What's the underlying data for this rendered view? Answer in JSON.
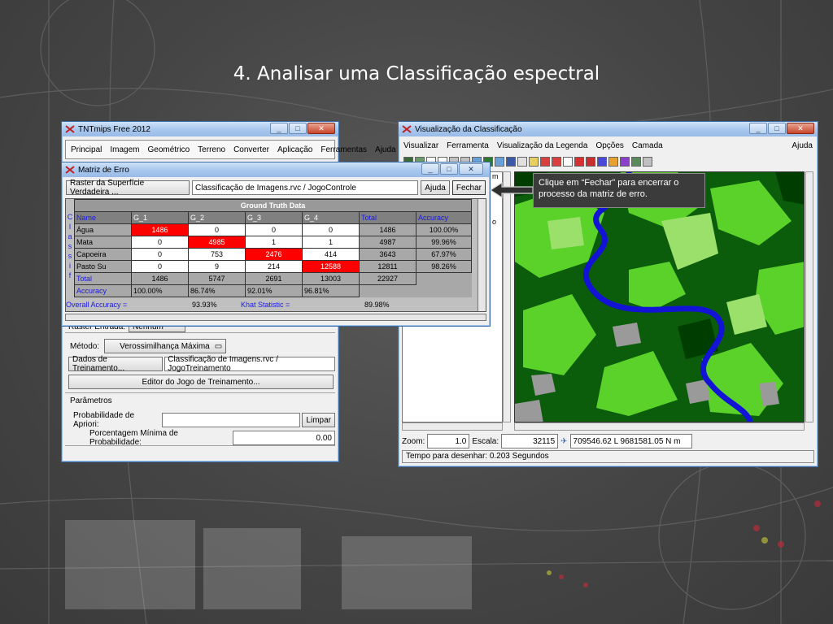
{
  "slide_title": "4. Analisar uma Classificação espectral",
  "tnt_window": {
    "title": "TNTmips Free 2012",
    "menu": [
      "Principal",
      "Imagem",
      "Geométrico",
      "Terreno",
      "Converter",
      "Aplicação",
      "Ferramentas",
      "Ajuda"
    ],
    "raster_entrada_label": "Raster Entrada:",
    "raster_entrada_value": "Nenhum",
    "metodo_label": "Método:",
    "metodo_value": "Verossimilhança Máxima",
    "dados_treinamento_button": "Dados de Treinamento...",
    "dados_treinamento_value": "Classificação de Imagens.rvc / JogoTreinamento",
    "editor_button": "Editor do Jogo de Treinamento...",
    "parametros_label": "Parâmetros",
    "prob_apriori_label": "Probabilidade de Apriori:",
    "limpar_button": "Limpar",
    "porcentagem_label": "Porcentagem Mínima de Probabilidade:",
    "porcentagem_value": "0.00"
  },
  "matriz_window": {
    "title": "Matriz de Erro",
    "raster_button": "Raster da Superfície Verdadeira ...",
    "raster_value": "Classificação de Imagens.rvc / JogoControle",
    "ajuda_button": "Ajuda",
    "fechar_button": "Fechar",
    "side_label": [
      "C",
      "l",
      "a",
      "s",
      "s",
      "i",
      "f"
    ],
    "ground_truth_label": "Ground Truth Data",
    "col_headers": [
      "Name",
      "G_1",
      "G_2",
      "G_3",
      "G_4",
      "Total",
      "Accuracy"
    ],
    "rows": [
      {
        "name": "Água",
        "values": [
          "1486",
          "0",
          "0",
          "0"
        ],
        "total": "1486",
        "accuracy": "100.00%"
      },
      {
        "name": "Mata",
        "values": [
          "0",
          "4985",
          "1",
          "1"
        ],
        "total": "4987",
        "accuracy": "99.96%"
      },
      {
        "name": "Capoeira",
        "values": [
          "0",
          "753",
          "2476",
          "414"
        ],
        "total": "3643",
        "accuracy": "67.97%"
      },
      {
        "name": "Pasto Su",
        "values": [
          "0",
          "9",
          "214",
          "12588"
        ],
        "total": "12811",
        "accuracy": "98.26%"
      }
    ],
    "total_row": {
      "label": "Total",
      "values": [
        "1486",
        "5747",
        "2691",
        "13003"
      ],
      "total": "22927"
    },
    "accuracy_row": {
      "label": "Accuracy",
      "values": [
        "100.00%",
        "86.74%",
        "92.01%",
        "96.81%"
      ]
    },
    "overall_label": "Overall Accuracy =",
    "overall_value": "93.93%",
    "khat_label": "Khat Statistic =",
    "khat_value": "89.98%"
  },
  "viz_window": {
    "title": "Visualização da Classificação",
    "menu": [
      "Visualizar",
      "Ferramenta",
      "Visualização da Legenda",
      "Opções",
      "Camada"
    ],
    "menu_right": "Ajuda",
    "zoom_label": "Zoom:",
    "zoom_value": "1.0",
    "escala_label": "Escala:",
    "escala_value": "32115",
    "coords": "709546.62 L  9681581.05 N m",
    "status": "Tempo para desenhar: 0.203 Segundos",
    "left_panel_fragments": [
      "m",
      "o"
    ]
  },
  "callout_text": "Clique em “Fechar” para encerrar o processo da matriz de erro.",
  "colors": {
    "accent_red": "#ff0000",
    "titlebar": "#a9c8ee",
    "map_dark_green": "#0b5d0b",
    "map_light_green": "#5ad22a",
    "map_river": "#1313d6",
    "map_gray": "#9a9a9a"
  }
}
